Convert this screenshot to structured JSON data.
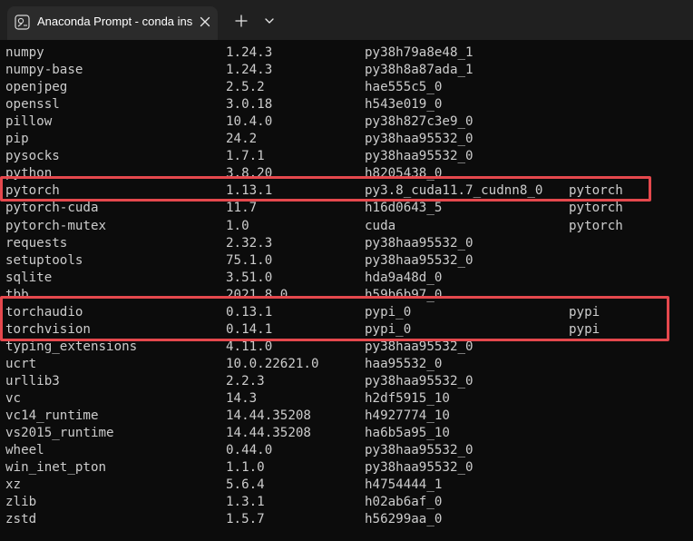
{
  "tab": {
    "title": "Anaconda Prompt - conda  ins",
    "icon": "terminal-icon",
    "close_icon": "close-icon"
  },
  "toolbar": {
    "new_tab_icon": "plus-icon",
    "dropdown_icon": "chevron-down-icon"
  },
  "colors": {
    "background": "#0c0c0c",
    "text": "#cccccc",
    "titlebar": "#202020",
    "tab": "#2b2b2b",
    "highlight": "#e5484d"
  },
  "packages": [
    {
      "name": "numpy",
      "version": "1.24.3",
      "build": "py38h79a8e48_1",
      "channel": ""
    },
    {
      "name": "numpy-base",
      "version": "1.24.3",
      "build": "py38h8a87ada_1",
      "channel": ""
    },
    {
      "name": "openjpeg",
      "version": "2.5.2",
      "build": "hae555c5_0",
      "channel": ""
    },
    {
      "name": "openssl",
      "version": "3.0.18",
      "build": "h543e019_0",
      "channel": ""
    },
    {
      "name": "pillow",
      "version": "10.4.0",
      "build": "py38h827c3e9_0",
      "channel": ""
    },
    {
      "name": "pip",
      "version": "24.2",
      "build": "py38haa95532_0",
      "channel": ""
    },
    {
      "name": "pysocks",
      "version": "1.7.1",
      "build": "py38haa95532_0",
      "channel": ""
    },
    {
      "name": "python",
      "version": "3.8.20",
      "build": "h8205438_0",
      "channel": ""
    },
    {
      "name": "pytorch",
      "version": "1.13.1",
      "build": "py3.8_cuda11.7_cudnn8_0",
      "channel": "pytorch"
    },
    {
      "name": "pytorch-cuda",
      "version": "11.7",
      "build": "h16d0643_5",
      "channel": "pytorch"
    },
    {
      "name": "pytorch-mutex",
      "version": "1.0",
      "build": "cuda",
      "channel": "pytorch"
    },
    {
      "name": "requests",
      "version": "2.32.3",
      "build": "py38haa95532_0",
      "channel": ""
    },
    {
      "name": "setuptools",
      "version": "75.1.0",
      "build": "py38haa95532_0",
      "channel": ""
    },
    {
      "name": "sqlite",
      "version": "3.51.0",
      "build": "hda9a48d_0",
      "channel": ""
    },
    {
      "name": "tbb",
      "version": "2021.8.0",
      "build": "h59b6b97_0",
      "channel": ""
    },
    {
      "name": "torchaudio",
      "version": "0.13.1",
      "build": "pypi_0",
      "channel": "pypi"
    },
    {
      "name": "torchvision",
      "version": "0.14.1",
      "build": "pypi_0",
      "channel": "pypi"
    },
    {
      "name": "typing_extensions",
      "version": "4.11.0",
      "build": "py38haa95532_0",
      "channel": ""
    },
    {
      "name": "ucrt",
      "version": "10.0.22621.0",
      "build": "haa95532_0",
      "channel": ""
    },
    {
      "name": "urllib3",
      "version": "2.2.3",
      "build": "py38haa95532_0",
      "channel": ""
    },
    {
      "name": "vc",
      "version": "14.3",
      "build": "h2df5915_10",
      "channel": ""
    },
    {
      "name": "vc14_runtime",
      "version": "14.44.35208",
      "build": "h4927774_10",
      "channel": ""
    },
    {
      "name": "vs2015_runtime",
      "version": "14.44.35208",
      "build": "ha6b5a95_10",
      "channel": ""
    },
    {
      "name": "wheel",
      "version": "0.44.0",
      "build": "py38haa95532_0",
      "channel": ""
    },
    {
      "name": "win_inet_pton",
      "version": "1.1.0",
      "build": "py38haa95532_0",
      "channel": ""
    },
    {
      "name": "xz",
      "version": "5.6.4",
      "build": "h4754444_1",
      "channel": ""
    },
    {
      "name": "zlib",
      "version": "1.3.1",
      "build": "h02ab6af_0",
      "channel": ""
    },
    {
      "name": "zstd",
      "version": "1.5.7",
      "build": "h56299aa_0",
      "channel": ""
    }
  ]
}
